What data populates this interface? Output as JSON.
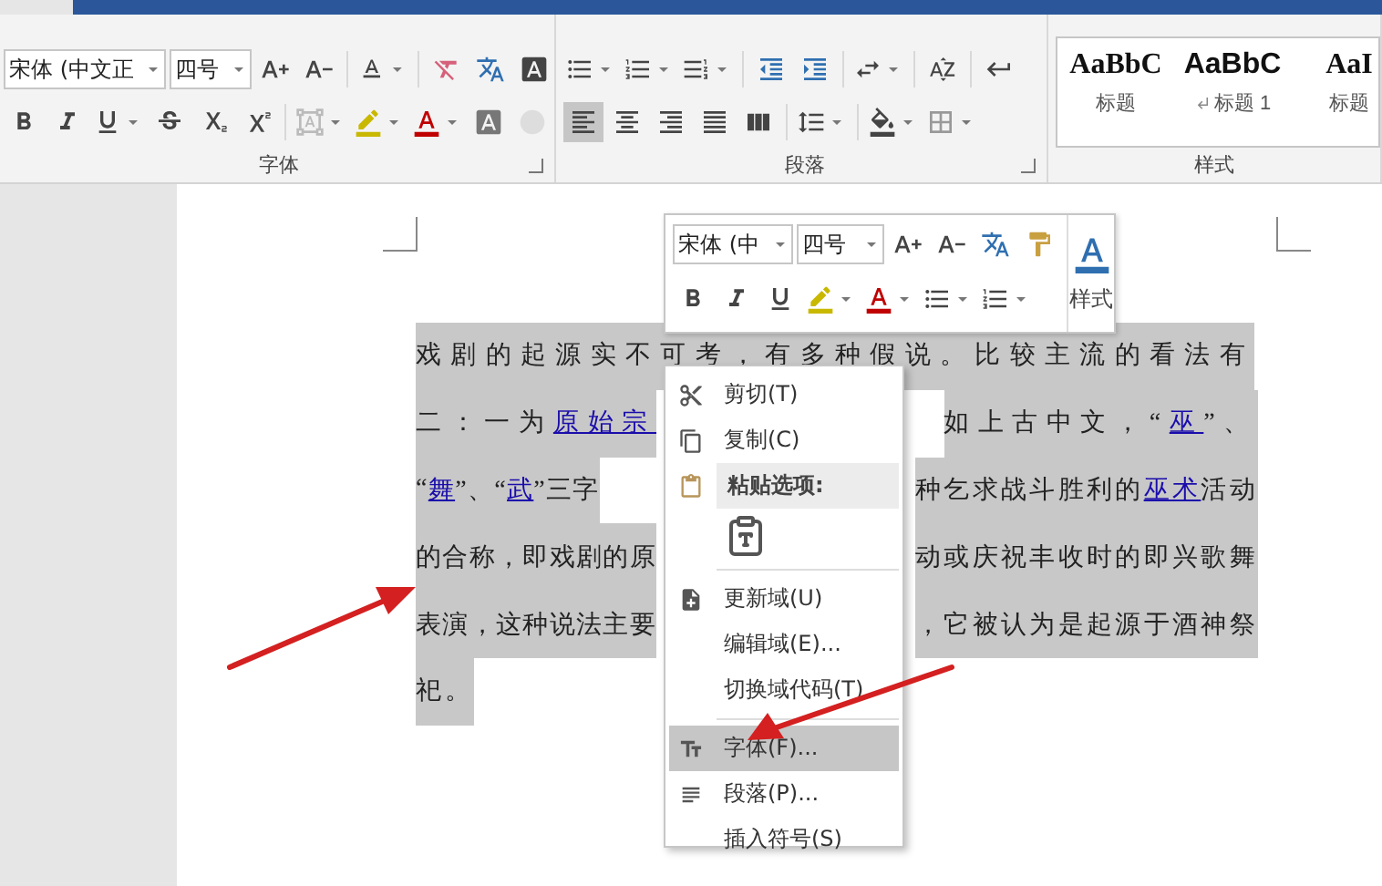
{
  "ribbon": {
    "font_group": {
      "label": "字体",
      "font_name": "宋体 (中文正",
      "font_size": "四号"
    },
    "paragraph_group": {
      "label": "段落",
      "alignment": [
        {
          "selected": true
        },
        {
          "selected": false
        },
        {
          "selected": false
        },
        {
          "selected": false
        },
        {
          "selected": false
        }
      ]
    },
    "styles_group": {
      "label": "样式",
      "styles": [
        {
          "preview": "AaBbC",
          "name": "标题",
          "kind": "plain"
        },
        {
          "preview": "AaBbC",
          "name": "标题 1",
          "kind": "heading"
        },
        {
          "preview": "AaI",
          "name": "标题",
          "kind": "plain"
        }
      ]
    }
  },
  "document": {
    "lines": [
      {
        "runs": [
          {
            "text": "戏剧的起源实不可考，有多种假说。比较主流的看法有",
            "link": false
          }
        ]
      },
      {
        "runs": [
          {
            "text": "二：一为",
            "link": false
          },
          {
            "text": "原始宗",
            "link": true
          }
        ],
        "right_runs": [
          {
            "text": "如上古中文，“",
            "link": false
          },
          {
            "text": "巫",
            "link": true
          },
          {
            "text": "”、",
            "link": false
          }
        ]
      },
      {
        "runs": [
          {
            "text": "“",
            "link": false
          },
          {
            "text": "舞",
            "link": true
          },
          {
            "text": "”、“",
            "link": false
          },
          {
            "text": "武",
            "link": true
          },
          {
            "text": "”三字",
            "link": false
          }
        ],
        "right_runs": [
          {
            "text": "种乞求战斗胜利的",
            "link": false
          },
          {
            "text": "巫术",
            "link": true
          },
          {
            "text": "活动",
            "link": false
          }
        ]
      },
      {
        "runs": [
          {
            "text": "的合称，即戏剧的原",
            "link": false
          }
        ],
        "right_runs": [
          {
            "text": "动或庆祝丰收时的即兴歌舞",
            "link": false
          }
        ]
      },
      {
        "runs": [
          {
            "text": "表演，这种说法主要",
            "link": false
          }
        ],
        "right_runs": [
          {
            "text": "，它被认为是起源于酒神祭",
            "link": false
          }
        ]
      },
      {
        "runs": [
          {
            "text": "祀。",
            "link": false
          }
        ]
      }
    ]
  },
  "mini_toolbar": {
    "font_name": "宋体 (中",
    "font_size": "四号",
    "styles_label": "样式"
  },
  "context_menu": {
    "items": [
      {
        "kind": "item",
        "label": "剪切(T)",
        "selected": false
      },
      {
        "kind": "item",
        "label": "复制(C)",
        "selected": false
      },
      {
        "kind": "header",
        "label": "粘贴选项:"
      },
      {
        "kind": "paste_option"
      },
      {
        "kind": "separator"
      },
      {
        "kind": "item",
        "label": "更新域(U)",
        "selected": false
      },
      {
        "kind": "item",
        "label": "编辑域(E)...",
        "selected": false
      },
      {
        "kind": "item",
        "label": "切换域代码(T)",
        "selected": false
      },
      {
        "kind": "separator"
      },
      {
        "kind": "item",
        "label": "字体(F)...",
        "selected": true
      },
      {
        "kind": "item",
        "label": "段落(P)...",
        "selected": false
      },
      {
        "kind": "item",
        "label": "插入符号(S)",
        "selected": false
      }
    ]
  }
}
